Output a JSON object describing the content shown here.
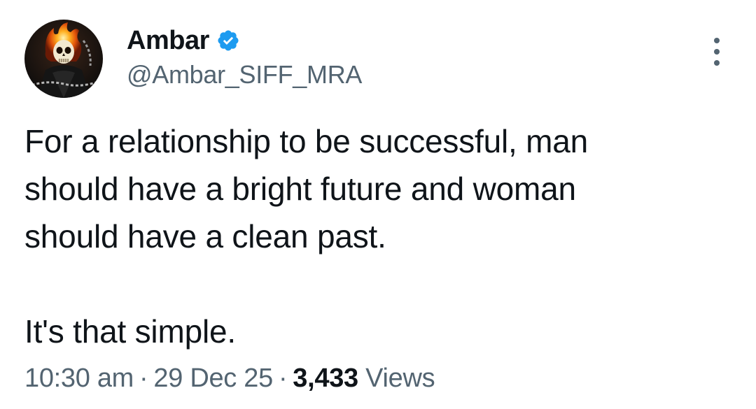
{
  "tweet": {
    "author": {
      "display_name": "Ambar",
      "handle": "@Ambar_SIFF_MRA",
      "verified": true,
      "avatar_icon": "ghost-rider-avatar"
    },
    "text": {
      "paragraph_1": "For a relationship to be successful, man\nshould have a bright future and woman\nshould have a clean past.",
      "paragraph_2": "It's that simple."
    },
    "meta": {
      "time": "10:30 am",
      "separator": "·",
      "date": "29 Dec 25",
      "views_count": "3,433",
      "views_label": "Views"
    },
    "more_options_icon": "more-vertical-icon"
  },
  "colors": {
    "text_primary": "#0f1419",
    "text_secondary": "#536471",
    "verified_blue": "#1d9bf0",
    "background": "#ffffff"
  }
}
